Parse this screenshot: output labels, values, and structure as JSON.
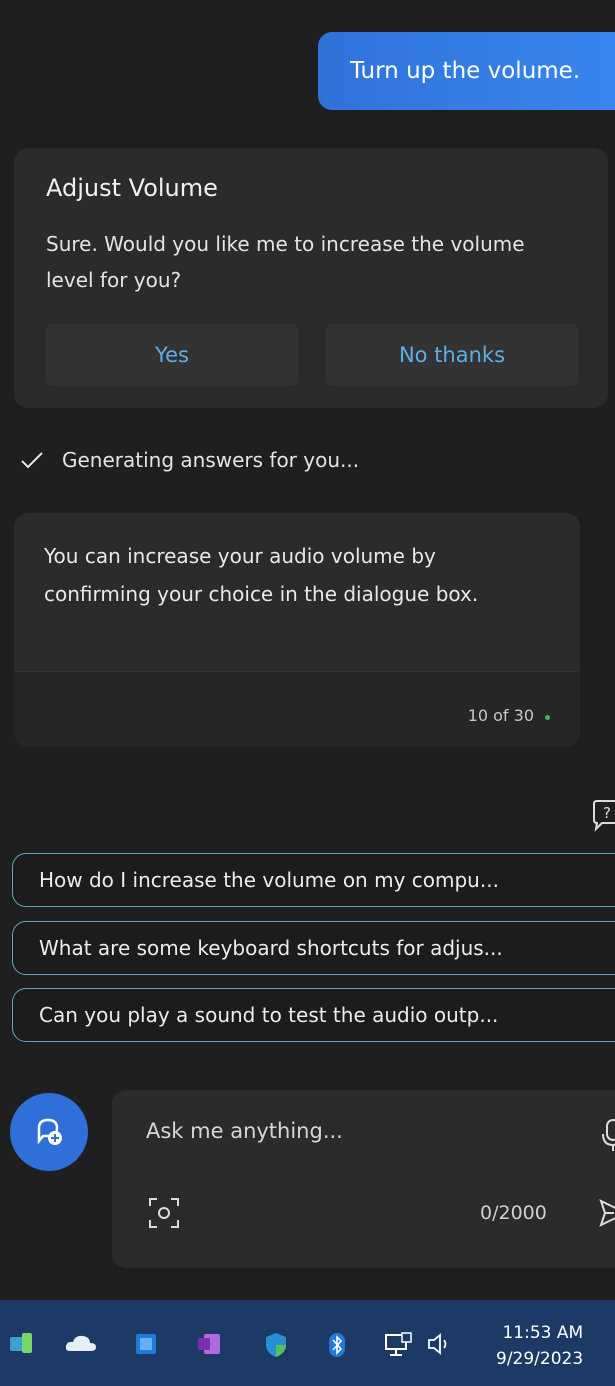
{
  "conversation": {
    "user_message": "Turn up the volume.",
    "volume_card": {
      "title": "Adjust Volume",
      "body": "Sure. Would you like me to increase the volume level for you?",
      "yes_label": "Yes",
      "no_label": "No thanks"
    },
    "status_text": "Generating answers for you...",
    "answer": {
      "text": "You can increase your audio volume by confirming your choice in the dialogue box.",
      "counter": "10 of 30"
    }
  },
  "suggestions": [
    "How do I increase the volume on my compu...",
    "What are some keyboard shortcuts for adjus...",
    "Can you play a sound to test the audio outp..."
  ],
  "composer": {
    "placeholder": "Ask me anything...",
    "char_count": "0/2000"
  },
  "taskbar": {
    "time": "11:53 AM",
    "date": "9/29/2023"
  },
  "colors": {
    "accent": "#2f73d9",
    "link": "#5ab0e6",
    "suggestion_border": "#5ca8c4",
    "taskbar": "#1d3a66"
  }
}
